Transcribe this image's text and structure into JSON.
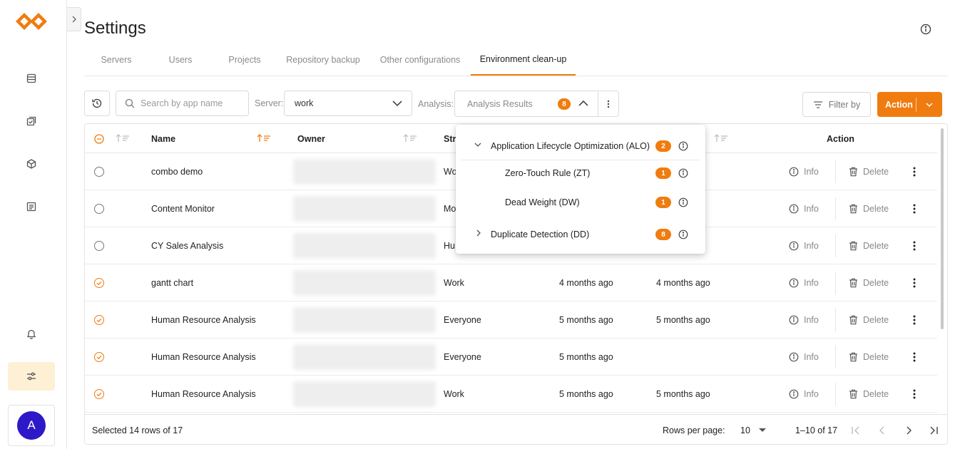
{
  "app": {
    "logo": "infinity-logo",
    "avatar_initial": "A"
  },
  "sidebar": {
    "items": [
      {
        "name": "database-icon"
      },
      {
        "name": "tasks-icon"
      },
      {
        "name": "package-icon"
      },
      {
        "name": "report-icon"
      },
      {
        "name": "bell-icon"
      },
      {
        "name": "sliders-icon",
        "active": true
      }
    ]
  },
  "header": {
    "title": "Settings"
  },
  "tabs": [
    {
      "label": "Servers"
    },
    {
      "label": "Users"
    },
    {
      "label": "Projects"
    },
    {
      "label": "Repository backup"
    },
    {
      "label": "Other configurations"
    },
    {
      "label": "Environment clean-up",
      "active": true
    }
  ],
  "toolbar": {
    "search_placeholder": "Search by app name",
    "server_label": "Server:",
    "server_value": "work",
    "analysis_label": "Analysis:",
    "analysis_value": "Analysis Results",
    "analysis_count": "8",
    "filter_label": "Filter by",
    "action_label": "Action"
  },
  "analysis_menu": [
    {
      "label": "Application Lifecycle Optimization (ALO)",
      "count": "2",
      "expanded": true
    },
    {
      "label": "Zero-Touch Rule (ZT)",
      "count": "1",
      "child": true
    },
    {
      "label": "Dead Weight (DW)",
      "count": "1",
      "child": true
    },
    {
      "label": "Duplicate Detection (DD)",
      "count": "8",
      "expanded": false
    }
  ],
  "table": {
    "headers": {
      "name": "Name",
      "owner": "Owner",
      "stream": "Str",
      "action": "Action"
    },
    "info_label": "Info",
    "delete_label": "Delete",
    "rows": [
      {
        "name": "combo demo",
        "stream": "Wo",
        "modified": "",
        "reloaded": "",
        "selected": false
      },
      {
        "name": "Content Monitor",
        "stream": "Mo",
        "modified": "",
        "reloaded": "",
        "selected": false
      },
      {
        "name": "CY Sales Analysis",
        "stream": "Hu",
        "modified": "",
        "reloaded": "o",
        "selected": false
      },
      {
        "name": "gantt chart",
        "stream": "Work",
        "modified": "4 months ago",
        "reloaded": "4 months ago",
        "selected": true
      },
      {
        "name": "Human Resource Analysis",
        "stream": "Everyone",
        "modified": "5 months ago",
        "reloaded": "5 months ago",
        "selected": true
      },
      {
        "name": "Human Resource Analysis",
        "stream": "Everyone",
        "modified": "5 months ago",
        "reloaded": "",
        "selected": true
      },
      {
        "name": "Human Resource Analysis",
        "stream": "Work",
        "modified": "5 months ago",
        "reloaded": "5 months ago",
        "selected": true
      }
    ]
  },
  "footer": {
    "selected_text": "Selected 14 rows of 17",
    "rows_per_page_label": "Rows per page:",
    "rows_per_page_value": "10",
    "range_text": "1–10 of 17"
  },
  "colors": {
    "accent": "#f07c0f",
    "avatar": "#2d19c7",
    "active_nav_bg": "#fdf0d5"
  }
}
